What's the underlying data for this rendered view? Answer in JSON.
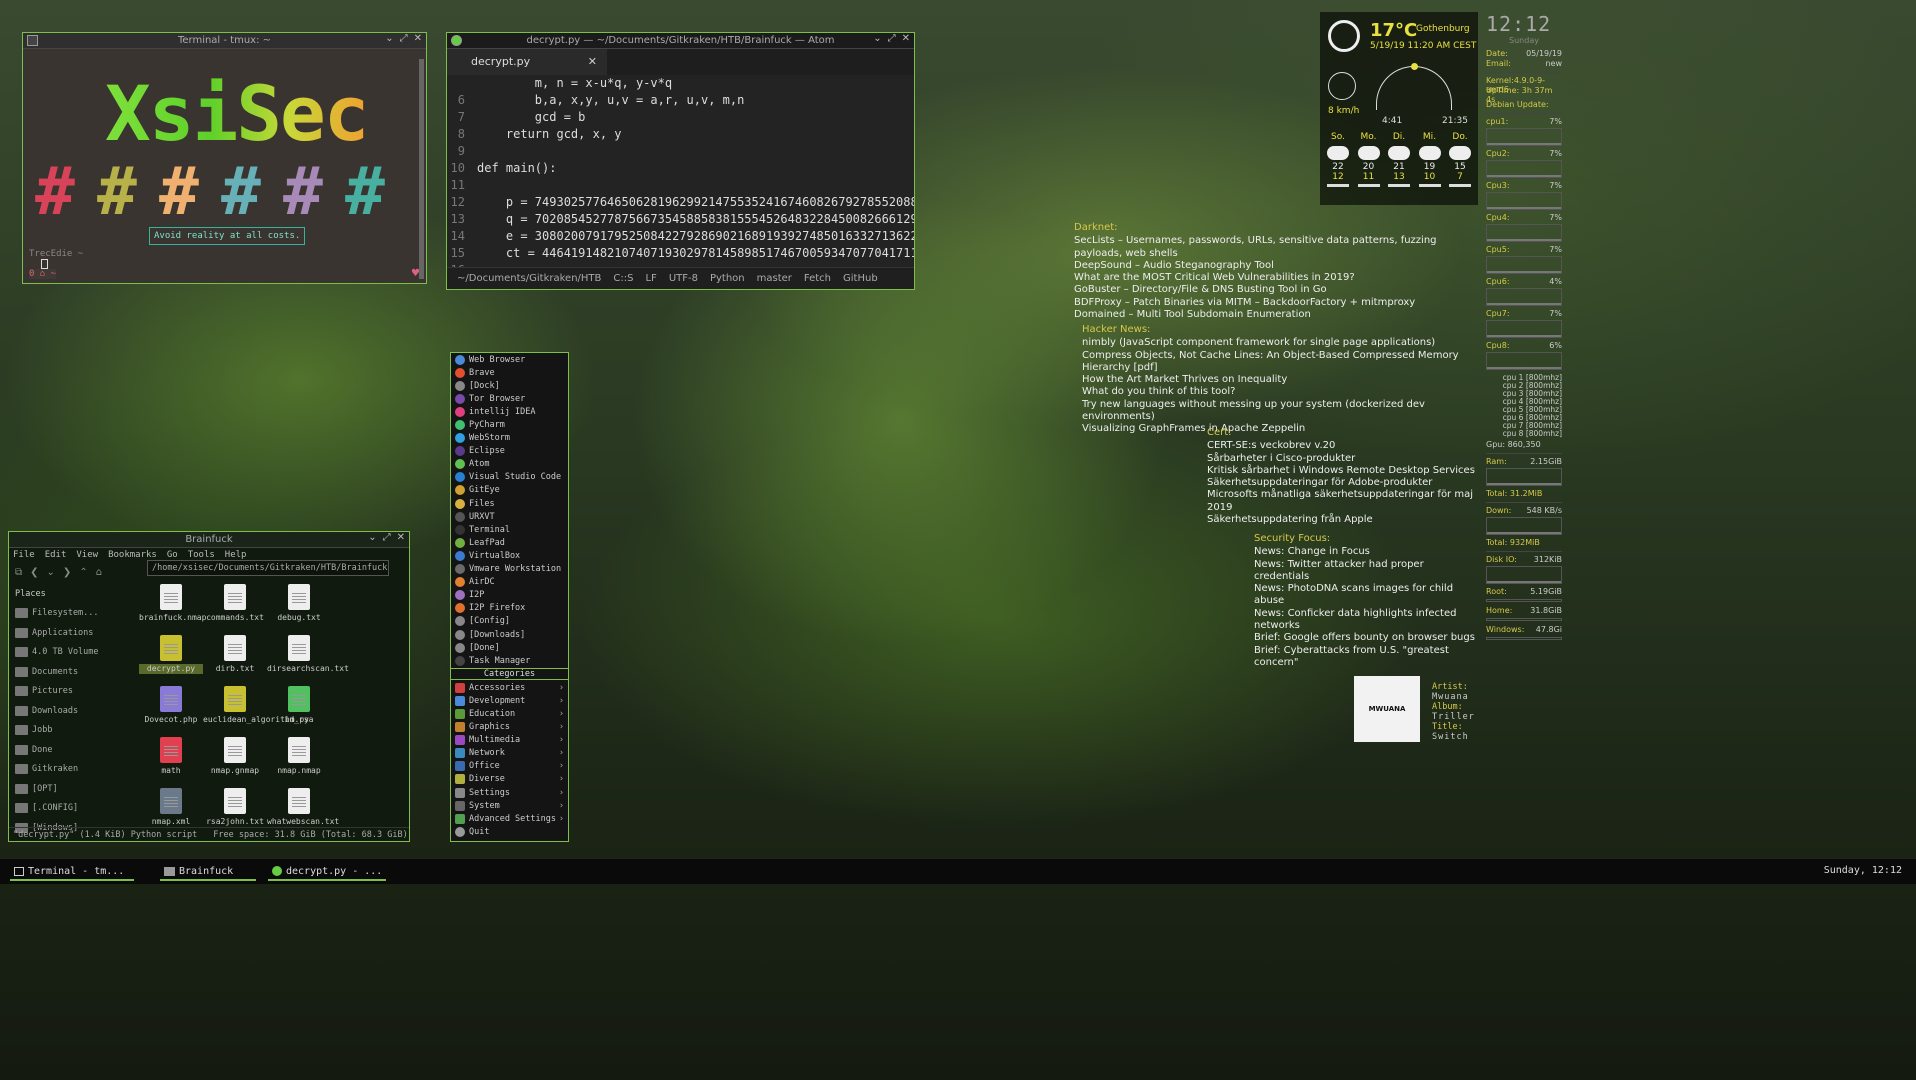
{
  "terminal": {
    "title": "Terminal - tmux: ~",
    "logo": "XsiSec",
    "hashes": [
      {
        "glyph": "#",
        "color": "#d9435a"
      },
      {
        "glyph": "#",
        "color": "#b8b048"
      },
      {
        "glyph": "#",
        "color": "#f0b070"
      },
      {
        "glyph": "#",
        "color": "#68b0b8"
      },
      {
        "glyph": "#",
        "color": "#a88ab8"
      },
      {
        "glyph": "#",
        "color": "#48b0a0"
      }
    ],
    "motto": "Avoid reality at all costs.",
    "prompt": "TrecEdie ~",
    "status": "0 ⌂ ~"
  },
  "atom": {
    "title": "decrypt.py — ~/Documents/Gitkraken/HTB/Brainfuck — Atom",
    "tab": "decrypt.py",
    "lines": [
      {
        "n": "",
        "t": "        m, n = x-u*q, y-v*q"
      },
      {
        "n": "6",
        "t": "        b,a, x,y, u,v = a,r, u,v, m,n"
      },
      {
        "n": "7",
        "t": "        gcd = b"
      },
      {
        "n": "8",
        "t": "    return gcd, x, y"
      },
      {
        "n": "9",
        "t": ""
      },
      {
        "n": "10",
        "t": "def main():"
      },
      {
        "n": "11",
        "t": ""
      },
      {
        "n": "12",
        "t": "    p = 749302577646506281962992147553524167460826792785520889"
      },
      {
        "n": "13",
        "t": "    q = 702085452778756673545885838155545264832284500826661290"
      },
      {
        "n": "14",
        "t": "    e = 308020079179525084227928690216891939274850163327136225"
      },
      {
        "n": "15",
        "t": "    ct = 446419148210740719302978145898517467005934707704171113"
      },
      {
        "n": "16",
        "t": "    ..."
      }
    ],
    "status": [
      "~/Documents/Gitkraken/HTB",
      "C::S",
      "LF",
      "UTF-8",
      "Python",
      "master",
      "Fetch",
      "GitHub"
    ]
  },
  "files": {
    "title": "Brainfuck",
    "menu": [
      "File",
      "Edit",
      "View",
      "Bookmarks",
      "Go",
      "Tools",
      "Help"
    ],
    "path": "/home/xsisec/Documents/Gitkraken/HTB/Brainfuck",
    "places_header": "Places",
    "places": [
      "Filesystem...",
      "Applications",
      "4.0 TB Volume",
      "Documents",
      "Pictures",
      "Downloads",
      "Jobb",
      "Done",
      "Gitkraken",
      "[OPT]",
      "[.CONFIG]",
      "[Windows]"
    ],
    "items": [
      {
        "name": "brainfuck.nmap",
        "kind": "doc"
      },
      {
        "name": "commands.txt",
        "kind": "doc"
      },
      {
        "name": "debug.txt",
        "kind": "doc"
      },
      {
        "name": "decrypt.py",
        "kind": "py"
      },
      {
        "name": "dirb.txt",
        "kind": "doc"
      },
      {
        "name": "dirsearchscan.txt",
        "kind": "doc"
      },
      {
        "name": "Dovecot.php",
        "kind": "php"
      },
      {
        "name": "euclidean_algorithm.py",
        "kind": "py"
      },
      {
        "name": "id_rsa",
        "kind": "key"
      },
      {
        "name": "math",
        "kind": "math"
      },
      {
        "name": "nmap.gnmap",
        "kind": "doc"
      },
      {
        "name": "nmap.nmap",
        "kind": "doc"
      },
      {
        "name": "nmap.xml",
        "kind": "xml"
      },
      {
        "name": "rsa2john.txt",
        "kind": "doc"
      },
      {
        "name": "whatwebscan.txt",
        "kind": "doc"
      }
    ],
    "status_left": "\"decrypt.py\" (1.4 KiB) Python script",
    "status_right": "Free space: 31.8 GiB (Total: 68.3 GiB)"
  },
  "appmenu": {
    "apps": [
      {
        "label": "Web Browser",
        "color": "#4a8ad8"
      },
      {
        "label": "Brave",
        "color": "#e05030"
      },
      {
        "label": "[Dock]",
        "color": "#888"
      },
      {
        "label": "Tor Browser",
        "color": "#7a4aa8"
      },
      {
        "label": "intellij IDEA",
        "color": "#e04080"
      },
      {
        "label": "PyCharm",
        "color": "#40c070"
      },
      {
        "label": "WebStorm",
        "color": "#30a0e0"
      },
      {
        "label": "Eclipse",
        "color": "#5a3a8a"
      },
      {
        "label": "Atom",
        "color": "#60c050"
      },
      {
        "label": "Visual Studio Code",
        "color": "#2a80d0"
      },
      {
        "label": "GitEye",
        "color": "#d0a030"
      },
      {
        "label": "Files",
        "color": "#d8b040"
      },
      {
        "label": "URXVT",
        "color": "#555"
      },
      {
        "label": "Terminal",
        "color": "#333"
      },
      {
        "label": "LeafPad",
        "color": "#70b040"
      },
      {
        "label": "VirtualBox",
        "color": "#3a7ad0"
      },
      {
        "label": "Vmware Workstation",
        "color": "#6a6a6a"
      },
      {
        "label": "AirDC",
        "color": "#e08030"
      },
      {
        "label": "I2P",
        "color": "#a070c0"
      },
      {
        "label": "I2P Firefox",
        "color": "#e07030"
      },
      {
        "label": "[Config]",
        "color": "#888"
      },
      {
        "label": "[Downloads]",
        "color": "#888"
      },
      {
        "label": "[Done]",
        "color": "#888"
      },
      {
        "label": "Task Manager",
        "color": "#444"
      }
    ],
    "categories_label": "Categories",
    "categories": [
      {
        "label": "Accessories",
        "color": "#d04040"
      },
      {
        "label": "Development",
        "color": "#4a8ad8"
      },
      {
        "label": "Education",
        "color": "#5a9a3a"
      },
      {
        "label": "Graphics",
        "color": "#c08030"
      },
      {
        "label": "Multimedia",
        "color": "#9a4ac0"
      },
      {
        "label": "Network",
        "color": "#3a8ac0"
      },
      {
        "label": "Office",
        "color": "#3a6ab0"
      },
      {
        "label": "Diverse",
        "color": "#b0b040"
      },
      {
        "label": "Settings",
        "color": "#888"
      },
      {
        "label": "System",
        "color": "#666"
      },
      {
        "label": "Advanced Settings",
        "color": "#50a050"
      }
    ],
    "quit": "Quit"
  },
  "feeds": [
    {
      "header": "Darknet:",
      "items": [
        "SecLists – Usernames, passwords, URLs, sensitive data patterns, fuzzing payloads, web shells",
        "DeepSound – Audio Steganography Tool",
        "What are the MOST Critical Web Vulnerabilities in 2019?",
        "GoBuster – Directory/File & DNS Busting Tool in Go",
        "BDFProxy – Patch Binaries via MITM – BackdoorFactory + mitmproxy",
        "Domained – Multi Tool Subdomain Enumeration"
      ]
    },
    {
      "header": "Hacker News:",
      "items": [
        "nimbly (JavaScript component framework for single page applications)",
        "Compress Objects, Not Cache Lines: An Object-Based Compressed Memory Hierarchy [pdf]",
        "How the Art Market Thrives on Inequality",
        "What do you think of this tool?",
        "Try new languages without messing up your system (dockerized dev environments)",
        "Visualizing GraphFrames in Apache Zeppelin"
      ]
    },
    {
      "header": "Cert:",
      "items": [
        "CERT-SE:s veckobrev v.20",
        "Sårbarheter i Cisco-produkter",
        "Kritisk sårbarhet i Windows Remote Desktop Services",
        "Säkerhetsuppdateringar för Adobe-produkter",
        "Microsofts månatliga säkerhetsuppdateringar för maj 2019",
        "Säkerhetsuppdatering från Apple"
      ]
    },
    {
      "header": "Security Focus:",
      "items": [
        "News: Change in Focus",
        "News: Twitter attacker had proper credentials",
        "News: PhotoDNA scans images for child abuse",
        "News: Conficker data highlights infected networks",
        "Brief: Google offers bounty on browser bugs",
        "Brief: Cyberattacks from U.S. \"greatest concern\""
      ]
    }
  ],
  "weather": {
    "temp": "17°C",
    "city": "Gothenburg",
    "date": "5/19/19 11:20 AM CEST",
    "wind": "8 km/h",
    "sunrise": "4:41",
    "sunset": "21:35",
    "days": [
      {
        "d": "So.",
        "hi": "22",
        "lo": "12"
      },
      {
        "d": "Mo.",
        "hi": "20",
        "lo": "11"
      },
      {
        "d": "Di.",
        "hi": "21",
        "lo": "13"
      },
      {
        "d": "Mi.",
        "hi": "19",
        "lo": "10"
      },
      {
        "d": "Do.",
        "hi": "15",
        "lo": "7"
      }
    ]
  },
  "sys": {
    "clock": "12:12",
    "day": "Sunday",
    "date_label": "Date:",
    "date": "05/19/19",
    "email_label": "Email:",
    "email": "new",
    "kernel": "Kernel:4.9.0-9-amd6",
    "uptime": "UpTime: 3h 37m 4s",
    "update": "Debian Update:",
    "cpus": [
      {
        "l": "cpu1:",
        "v": "7%"
      },
      {
        "l": "Cpu2:",
        "v": "7%"
      },
      {
        "l": "Cpu3:",
        "v": "7%"
      },
      {
        "l": "Cpu4:",
        "v": "7%"
      },
      {
        "l": "Cpu5:",
        "v": "7%"
      },
      {
        "l": "Cpu6:",
        "v": "4%"
      },
      {
        "l": "Cpu7:",
        "v": "7%"
      },
      {
        "l": "Cpu8:",
        "v": "6%"
      }
    ],
    "freqs": [
      "cpu 1 [800mhz]",
      "cpu 2 [800mhz]",
      "cpu 3 [800mhz]",
      "cpu 4 [800mhz]",
      "cpu 5 [800mhz]",
      "cpu 6 [800mhz]",
      "cpu 7 [800mhz]",
      "cpu 8 [800mhz]"
    ],
    "gpu": "Gpu: 860,350",
    "ram": {
      "l": "Ram:",
      "v": "2.15GiB",
      "total": "Total: 31.2MiB"
    },
    "down": {
      "l": "Down:",
      "v": "548 KB/s",
      "total": "Total: 932MiB"
    },
    "disk": {
      "l": "Disk IO:",
      "v": "312KiB"
    },
    "root": {
      "l": "Root:",
      "v": "5.19GiB"
    },
    "home": {
      "l": "Home:",
      "v": "31.8GiB"
    },
    "windows": {
      "l": "Windows:",
      "v": "47.8Gi"
    }
  },
  "music": {
    "cover": "MWUANA",
    "artist_label": "Artist:",
    "artist": "Mwuana",
    "album_label": "Album:",
    "album": "Triller",
    "title_label": "Title:",
    "title": "Switch"
  },
  "taskbar": {
    "items": [
      "Terminal - tm...",
      "Brainfuck",
      "decrypt.py - ..."
    ],
    "clock": "Sunday, 12:12"
  }
}
